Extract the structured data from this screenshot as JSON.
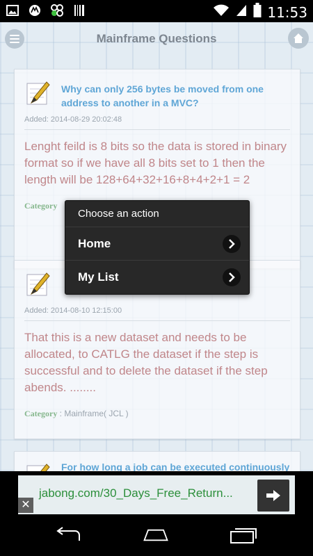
{
  "status_bar": {
    "time": "11:53",
    "left_icons": [
      "image-icon",
      "motorola-icon",
      "clover-icon",
      "barcode-icon"
    ],
    "right_icons": [
      "wifi-icon",
      "signal-icon",
      "battery-icon"
    ]
  },
  "header": {
    "title": "Mainframe Questions",
    "menu_icon": "menu-icon",
    "home_icon": "home-icon"
  },
  "cards": [
    {
      "question": "Why can only 256 bytes be moved from one address to another in a MVC?",
      "added": "Added: 2014-08-29 20:02:48",
      "answer": "Lenght feild is 8 bits so the data is stored in binary format so if we have all 8 bits set to 1 then the length will be 128+64+32+16+8+4+2+1 = 2",
      "category_label": "Category",
      "category_value": ""
    },
    {
      "question": "",
      "added": "Added: 2014-08-10 12:15:00",
      "answer": "That this is a new dataset and needs to be allocated, to CATLG the dataset if the step is successful and to delete the dataset if the step abends.    ........",
      "category_label": "Category",
      "category_value": ": Mainframe( JCL )"
    },
    {
      "question": "For how long a job can be executed continuously",
      "added": "",
      "answer": "",
      "category_label": "",
      "category_value": ""
    }
  ],
  "dialog": {
    "title": "Choose an action",
    "items": [
      {
        "label": "Home"
      },
      {
        "label": "My List"
      }
    ]
  },
  "ad": {
    "text": "jabong.com/30_Days_Free_Return...",
    "close_label": "✕"
  },
  "colors": {
    "accent_blue": "#5fa6d6",
    "answer_rose": "#c0868a",
    "category_green": "#86b78d",
    "ad_green": "#2c8f3b",
    "dialog_bg": "#282828"
  }
}
